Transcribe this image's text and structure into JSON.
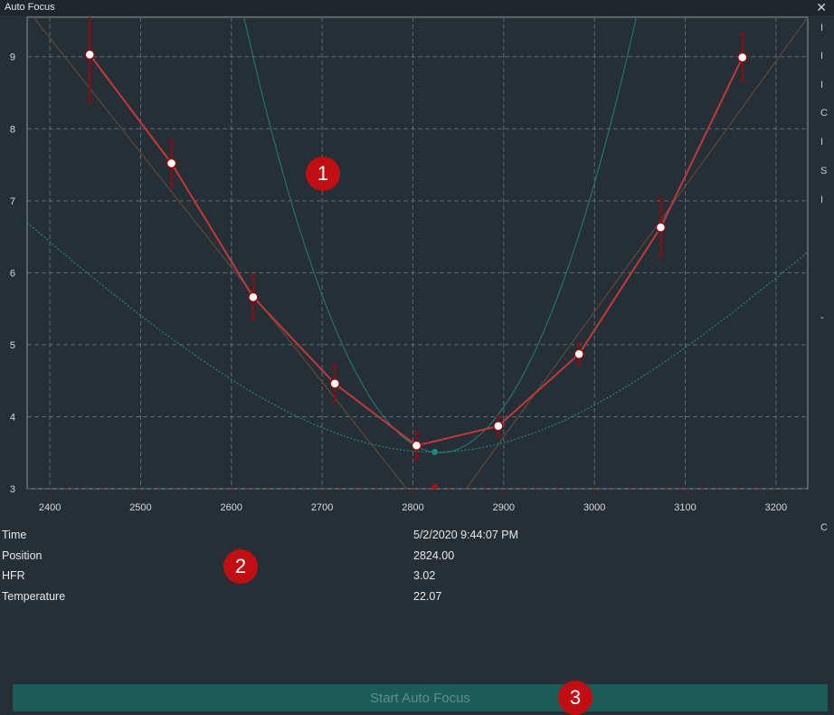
{
  "window": {
    "title": "Auto Focus",
    "close_icon": "close-icon"
  },
  "chart_data": {
    "type": "scatter",
    "xlim": [
      2375,
      3235
    ],
    "ylim": [
      3,
      9.55
    ],
    "x_ticks": [
      2400,
      2500,
      2600,
      2700,
      2800,
      2900,
      3000,
      3100,
      3200
    ],
    "y_ticks": [
      3,
      4,
      5,
      6,
      7,
      8,
      9
    ],
    "grid": true,
    "points": [
      {
        "x": 2444,
        "y": 9.03,
        "err": 0.65
      },
      {
        "x": 2534,
        "y": 7.52,
        "err": 0.33
      },
      {
        "x": 2624,
        "y": 5.66,
        "err": 0.31
      },
      {
        "x": 2714,
        "y": 4.46,
        "err": 0.25
      },
      {
        "x": 2804,
        "y": 3.6,
        "err": 0.2
      },
      {
        "x": 2894,
        "y": 3.87,
        "err": 0.13
      },
      {
        "x": 2983,
        "y": 4.87,
        "err": 0.15
      },
      {
        "x": 3073,
        "y": 6.63,
        "err": 0.4
      },
      {
        "x": 3163,
        "y": 8.99,
        "err": 0.33
      }
    ],
    "hyperbolic_min": {
      "x": 2824,
      "y": 3.51
    },
    "trend_left": {
      "x1": 2355,
      "y1": 9.98,
      "x2": 2820,
      "y2": 2.57
    },
    "trend_right": {
      "x1": 2830,
      "y1": 2.5,
      "x2": 3235,
      "y2": 9.55
    },
    "trend_intersection": {
      "x": 2824,
      "y": 3.02
    },
    "parabola": {
      "a": 0.0001295,
      "h": 2830,
      "k": 3.5
    },
    "colors": {
      "plot_bg": "#262f35",
      "grid": "#5d6b72",
      "axis": "#8d979c",
      "data_line": "#c0393b",
      "error_bar": "#8e0c10",
      "hyperbola": "#1b8a84",
      "parabola": "#1f7a73",
      "trend": "#5a4a3f",
      "tick_label": "#d6dadd"
    }
  },
  "info": {
    "rows": [
      {
        "label": "Time",
        "value": "5/2/2020 9:44:07 PM"
      },
      {
        "label": "Position",
        "value": "2824.00"
      },
      {
        "label": "HFR",
        "value": "3.02"
      },
      {
        "label": "Temperature",
        "value": "22.07"
      }
    ]
  },
  "badges": [
    "1",
    "2",
    "3"
  ],
  "side_fragments": [
    "I",
    "I",
    "I",
    "C",
    "I",
    "S",
    "I",
    "-",
    "C"
  ],
  "actions": {
    "start_label": "Start Auto Focus"
  }
}
